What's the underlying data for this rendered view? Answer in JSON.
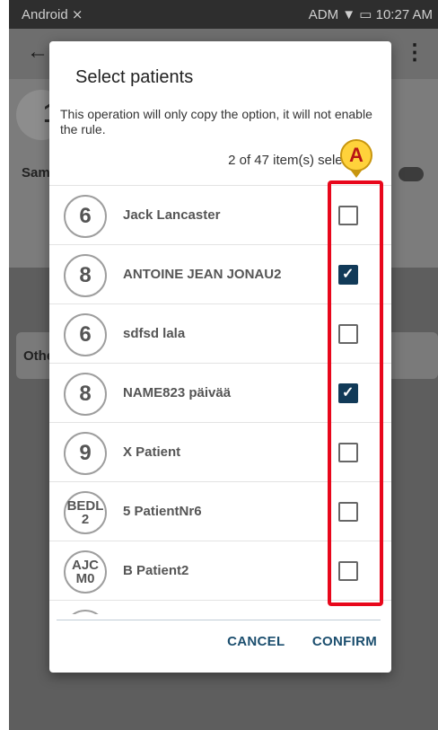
{
  "statusbar": {
    "left": "Android ⨯",
    "right": "ADM ▼ ▭ 10:27 AM"
  },
  "appbar": {
    "back_icon": "←",
    "menu_icon": "⋮"
  },
  "background": {
    "badge_number": "1",
    "sample_label": "Samp",
    "other_label": "Othe"
  },
  "dialog": {
    "title": "Select patients",
    "description": "This operation will only copy the option, it will not enable the rule.",
    "count": "2 of 47 item(s) selected",
    "patients": [
      {
        "bed": "6",
        "name": "Jack Lancaster",
        "checked": false
      },
      {
        "bed": "8",
        "name": "ANTOINE JEAN JONAU2",
        "checked": true
      },
      {
        "bed": "6",
        "name": "sdfsd lala",
        "checked": false
      },
      {
        "bed": "8",
        "name": "NAME823 päivää",
        "checked": true
      },
      {
        "bed": "9",
        "name": "X Patient",
        "checked": false
      },
      {
        "bed": "BEDL 2",
        "name": "5 PatientNr6",
        "checked": false
      },
      {
        "bed": "AJC M0",
        "name": "B Patient2",
        "checked": false
      }
    ],
    "cancel_label": "CANCEL",
    "confirm_label": "CONFIRM"
  },
  "annotation": {
    "marker": "A",
    "color": "#e8071b"
  }
}
